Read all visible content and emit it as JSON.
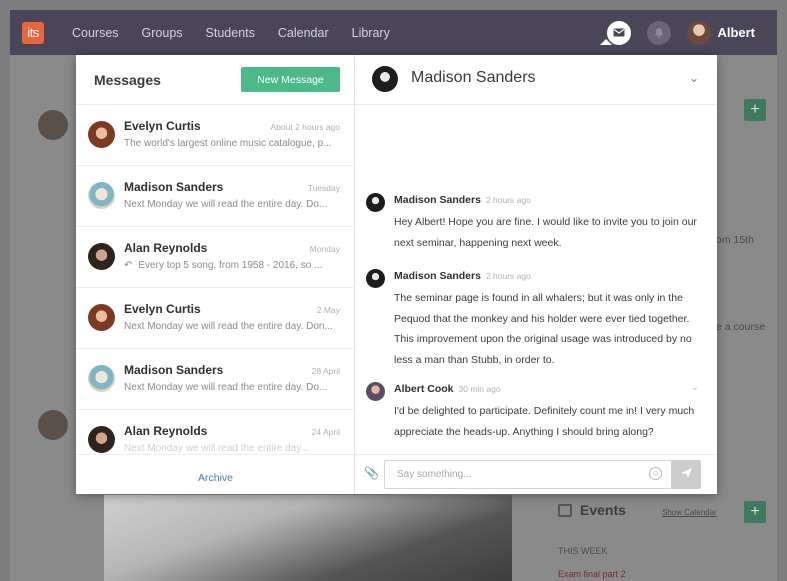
{
  "nav": {
    "logo": "its",
    "items": [
      {
        "label": "Courses"
      },
      {
        "label": "Groups"
      },
      {
        "label": "Students"
      },
      {
        "label": "Calendar"
      },
      {
        "label": "Library"
      }
    ],
    "icons": {
      "messages": "envelope-icon",
      "notifications": "bell-icon"
    },
    "user_name": "Albert"
  },
  "background": {
    "text_1": "om 15th",
    "text_2": "e a course",
    "events_label": "Events",
    "show_calendar": "Show Calendar",
    "this_week": "THIS WEEK",
    "event_item": "Exam final part 2"
  },
  "messages_panel": {
    "title": "Messages",
    "new_message_label": "New Message",
    "archive_label": "Archive",
    "items": [
      {
        "name": "Evelyn Curtis",
        "time": "About 2 hours ago",
        "preview": "The world's largest online music catalogue, p..."
      },
      {
        "name": "Madison Sanders",
        "time": "Tuesday",
        "preview": "Next Monday we will read the entire day. Do..."
      },
      {
        "name": "Alan Reynolds",
        "time": "Monday",
        "preview": "Every top 5 song, from 1958 - 2016, so ..."
      },
      {
        "name": "Evelyn Curtis",
        "time": "2 May",
        "preview": "Next Monday we will read the entire day. Don..."
      },
      {
        "name": "Madison Sanders",
        "time": "28 April",
        "preview": "Next Monday we will read the entire day. Do..."
      },
      {
        "name": "Alan Reynolds",
        "time": "24 April",
        "preview": "Next Monday we will read the entire day..."
      }
    ]
  },
  "conversation": {
    "contact_name": "Madison Sanders",
    "messages": [
      {
        "author": "Madison Sanders",
        "time": "2 hours ago",
        "text": "Hey Albert! Hope you are fine. I would like to invite you to join our next seminar, happening next week."
      },
      {
        "author": "Madison Sanders",
        "time": "2 hours ago",
        "text": "The seminar page is found in all whalers; but it was only in the Pequod that the monkey and his holder were ever tied together. This improvement upon the original usage was introduced by no less a man than Stubb, in order to."
      },
      {
        "author": "Albert Cook",
        "time": "30 min ago",
        "text": "I'd be delighted to participate. Definitely count me in! I very much appreciate the heads-up. Anything I should bring along?"
      }
    ],
    "input_placeholder": "Say something..."
  }
}
